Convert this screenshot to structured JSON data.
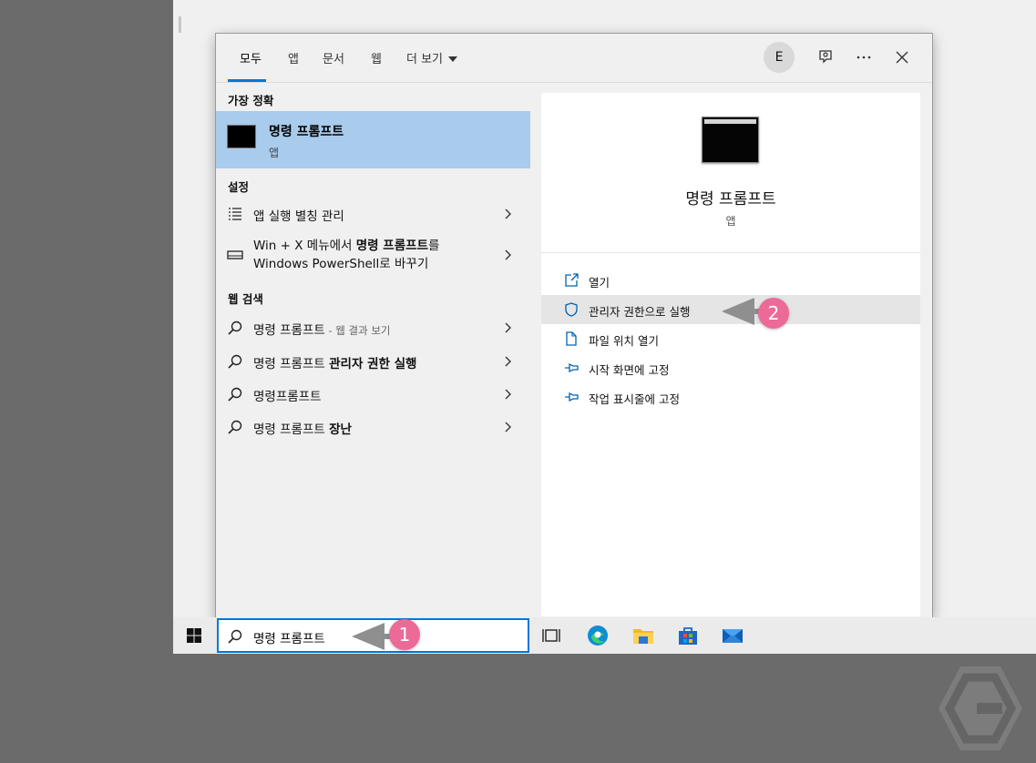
{
  "tabs": [
    {
      "label": "모두"
    },
    {
      "label": "앱"
    },
    {
      "label": "문서"
    },
    {
      "label": "웹"
    },
    {
      "label": "더 보기"
    }
  ],
  "header": {
    "avatar_letter": "E"
  },
  "left": {
    "best_match_header": "가장 정확",
    "best_match": {
      "title": "명령 프롬프트",
      "subtitle": "앱"
    },
    "settings_header": "설정",
    "settings": [
      {
        "label": "앱 실행 별칭 관리"
      },
      {
        "pre": "Win + X 메뉴에서 ",
        "bold": "명령 프롬프트",
        "post": "를",
        "line2": "Windows PowerShell로 바꾸기"
      }
    ],
    "web_header": "웹 검색",
    "web": [
      {
        "label": "명령 프롬프트",
        "hint": " - 웹 결과 보기"
      },
      {
        "label": "명령 프롬프트 ",
        "bold": "관리자 권한 실행"
      },
      {
        "label": "명령프롬프트"
      },
      {
        "label": "명령 프롬프트 ",
        "bold": "장난"
      }
    ]
  },
  "preview": {
    "title": "명령 프롬프트",
    "subtitle": "앱",
    "actions": [
      {
        "label": "열기",
        "icon": "open-icon"
      },
      {
        "label": "관리자 권한으로 실행",
        "icon": "shield-icon"
      },
      {
        "label": "파일 위치 열기",
        "icon": "file-location-icon"
      },
      {
        "label": "시작 화면에 고정",
        "icon": "pin-icon"
      },
      {
        "label": "작업 표시줄에 고정",
        "icon": "pin-icon"
      }
    ]
  },
  "taskbar": {
    "search_value": "명령 프롬프트",
    "icons": [
      "task-view-icon",
      "edge-icon",
      "file-explorer-icon",
      "store-icon",
      "mail-icon"
    ]
  },
  "annotations": {
    "badge1": "1",
    "badge2": "2"
  },
  "colors": {
    "accent": "#0078d7",
    "selection": "#a9cbec",
    "badge": "#ec6a98"
  }
}
